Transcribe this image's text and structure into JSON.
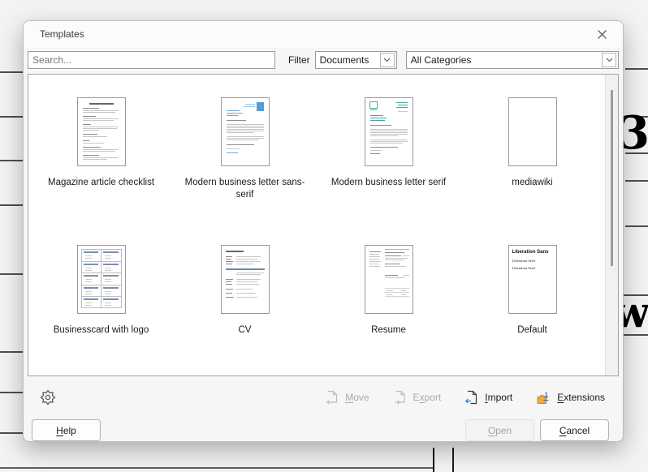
{
  "window": {
    "title": "Templates"
  },
  "filter_bar": {
    "search_placeholder": "Search...",
    "filter_label": "Filter",
    "type_value": "Documents",
    "category_value": "All Categories"
  },
  "templates": [
    {
      "name": "Magazine article checklist"
    },
    {
      "name": "Modern business letter sans-serif"
    },
    {
      "name": "Modern business letter serif"
    },
    {
      "name": "mediawiki"
    },
    {
      "name": "Businesscard with logo"
    },
    {
      "name": "CV"
    },
    {
      "name": "Resume"
    },
    {
      "name": "Default"
    }
  ],
  "thumbs": {
    "default": {
      "heading": "Liberation Sans",
      "line1": "Liberation Serif",
      "line2": "Liberation Serif"
    }
  },
  "toolbar": {
    "move": {
      "pre": "",
      "key": "M",
      "post": "ove",
      "enabled": false
    },
    "export": {
      "pre": "E",
      "key": "x",
      "post": "port",
      "enabled": false
    },
    "import": {
      "pre": "",
      "key": "I",
      "post": "mport",
      "enabled": true
    },
    "extensions": {
      "pre": "",
      "key": "E",
      "post": "xtensions",
      "enabled": true
    }
  },
  "footer": {
    "help": {
      "pre": "",
      "key": "H",
      "post": "elp",
      "enabled": true
    },
    "open": {
      "pre": "",
      "key": "O",
      "post": "pen",
      "enabled": false
    },
    "cancel": {
      "pre": "",
      "key": "C",
      "post": "ancel",
      "enabled": true
    }
  },
  "background": {
    "fragment_top": "3",
    "fragment_bottom": "wa"
  },
  "icons": {
    "close": "x-icon",
    "dropdown": "chevron-down-icon",
    "settings": "gear-icon",
    "move": "document-move-icon",
    "export": "document-export-icon",
    "import": "document-import-icon",
    "extensions": "puzzle-icon"
  },
  "colors": {
    "accent_blue": "#3b78c4",
    "puzzle_orange": "#f5a83c",
    "thumb_blue": "#5b9bd5",
    "thumb_teal": "#49a8a2",
    "dialog_bg": "#f6f6f6",
    "disabled_text": "#a9a9a9"
  }
}
